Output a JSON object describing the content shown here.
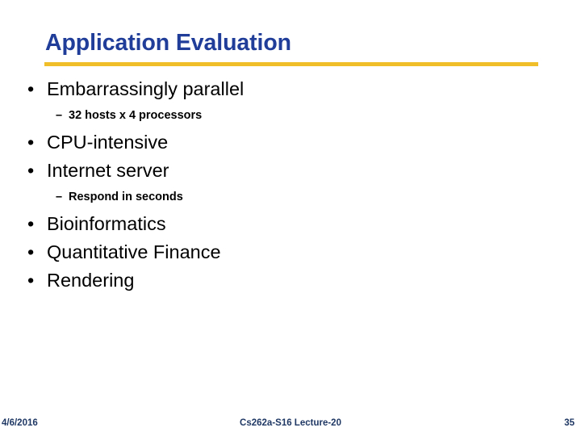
{
  "slide": {
    "title": "Application Evaluation",
    "accent_rule_color": "#efbe28",
    "title_color": "#1f3d99",
    "body_color": "#000000",
    "footer_color": "#1f3864",
    "background_color": "#ffffff"
  },
  "body": {
    "bullets": [
      {
        "level": 1,
        "marker": "•",
        "text": "Embarrassingly parallel"
      },
      {
        "level": 2,
        "marker": "–",
        "text": "32 hosts x 4 processors"
      },
      {
        "level": 1,
        "marker": "•",
        "text": "CPU-intensive"
      },
      {
        "level": 1,
        "marker": "•",
        "text": "Internet server"
      },
      {
        "level": 2,
        "marker": "–",
        "text": "Respond in seconds"
      },
      {
        "level": 1,
        "marker": "•",
        "text": "Bioinformatics"
      },
      {
        "level": 1,
        "marker": "•",
        "text": "Quantitative Finance"
      },
      {
        "level": 1,
        "marker": "•",
        "text": "Rendering"
      }
    ]
  },
  "footer": {
    "date": "4/6/2016",
    "center": "Cs262a-S16 Lecture-20",
    "page_number": "35"
  }
}
